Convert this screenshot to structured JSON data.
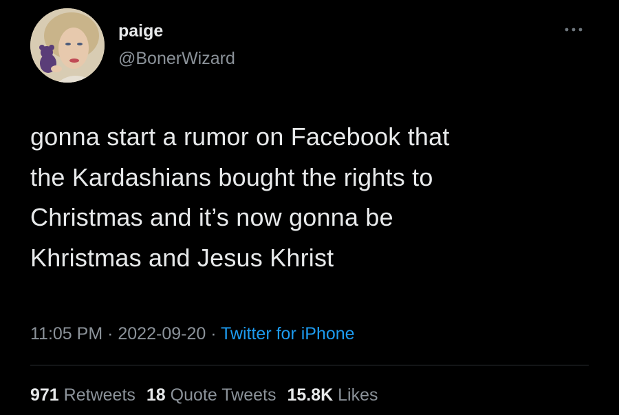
{
  "author": {
    "name": "paige",
    "handle": "@BonerWizard"
  },
  "tweet": {
    "lines": [
      "gonna start a rumor on Facebook that",
      "the Kardashians bought the rights to",
      "Christmas and it’s now gonna be",
      "Khristmas and Jesus Khrist"
    ]
  },
  "meta": {
    "time": "11:05 PM",
    "separator": " · ",
    "date": "2022-09-20",
    "source": "Twitter for iPhone"
  },
  "stats": {
    "retweets": {
      "count": "971",
      "label": "Retweets"
    },
    "quotes": {
      "count": "18",
      "label": "Quote Tweets"
    },
    "likes": {
      "count": "15.8K",
      "label": "Likes"
    }
  },
  "colors": {
    "background": "#000000",
    "primary_text": "#e7e9ea",
    "secondary_text": "#8b9299",
    "link": "#1d9bf0",
    "divider": "#2f3336"
  },
  "icons": {
    "more": "more-horizontal-icon"
  }
}
